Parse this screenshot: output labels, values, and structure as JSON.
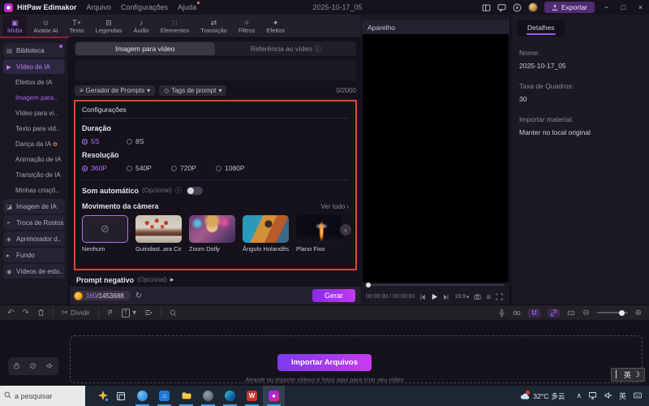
{
  "colors": {
    "accent": "#a873f5",
    "annotation_red": "#df4630",
    "export_purple": "#4f2b72",
    "generate_gradient": [
      "#8a2be2",
      "#bf3bf2"
    ],
    "import_gradient": [
      "#7c3aed",
      "#c93bf0"
    ],
    "taskbar_underline": "#4a9de8"
  },
  "glyphs": {
    "undo": "↶",
    "redo": "↷",
    "scissors": "✂",
    "none": "⊘",
    "info": "ⓘ",
    "caret_down": "▾",
    "caret_right": "▸",
    "chevron_right": "›",
    "next_arrow": "›",
    "refresh": "↻",
    "play": "▶",
    "grid": "⊞",
    "zoom_out": "⊖",
    "zoom_in": "⊕",
    "generator": "≡",
    "tag": "◇",
    "moon": "☽",
    "cursor": "▏",
    "caret_up": "∧",
    "danca": "✿"
  },
  "titlebar": {
    "app_name": "HitPaw Edimakor",
    "menus": [
      "Arquivo",
      "Configurações",
      "Ajuda"
    ],
    "project_name": "2025-10-17_05",
    "export_label": "Exportar",
    "minimize": "−",
    "maximize": "□",
    "close": "×"
  },
  "ribbon": {
    "tabs": [
      {
        "label": "Mídia",
        "icon": "▣"
      },
      {
        "label": "Avatar AI",
        "icon": "☺"
      },
      {
        "label": "Texto",
        "icon": "T+"
      },
      {
        "label": "Legendas",
        "icon": "⊟"
      },
      {
        "label": "Áudio",
        "icon": "♪"
      },
      {
        "label": "Elementos",
        "icon": "∷"
      },
      {
        "label": "Transição",
        "icon": "⇄"
      },
      {
        "label": "Filtros",
        "icon": "✧"
      },
      {
        "label": "Efeitos",
        "icon": "✦"
      }
    ]
  },
  "sidebar": {
    "items": [
      {
        "label": "Biblioteca",
        "icon": "▤"
      },
      {
        "label": "Vídeo de IA",
        "icon": "▶"
      },
      {
        "label": "Efeitos de IA"
      },
      {
        "label": "Imagem para.."
      },
      {
        "label": "Vídeo para vi.."
      },
      {
        "label": "Texto para vid.."
      },
      {
        "label": "Dança da IA"
      },
      {
        "label": "Animação de IA"
      },
      {
        "label": "Transição de IA"
      },
      {
        "label": "Minhas criaçõ.."
      },
      {
        "label": "Imagem de IA",
        "icon": "◪"
      },
      {
        "label": "Troca de Rostos",
        "icon": "◓"
      },
      {
        "label": "Aprimorador d..",
        "icon": "◈"
      },
      {
        "label": "Fundo",
        "icon": "▸"
      },
      {
        "label": "Vídeos de esto..",
        "icon": "◉"
      }
    ]
  },
  "main": {
    "tabs": [
      {
        "label": "Imagem para vídeo"
      },
      {
        "label": "Referência ao vídeo"
      }
    ],
    "prompt_generator": "Gerador de Prompts",
    "prompt_tags": "Tags de prompt",
    "char_counter": "0/2000",
    "settings": {
      "title": "Configurações",
      "duration_label": "Duração",
      "duration_options": [
        "5S",
        "8S"
      ],
      "resolution_label": "Resolução",
      "resolution_options": [
        "360P",
        "540P",
        "720P",
        "1080P"
      ],
      "auto_sound_label": "Som automático",
      "optional_label": "(Opcional)",
      "camera_label": "Movimento da câmera",
      "see_all": "Ver tudo",
      "camera_options": [
        "Nenhum",
        "Guindast..ara Cima",
        "Zoom Dolly",
        "Ângulo Holandês",
        "Plano Fixo"
      ]
    },
    "negative_prompt_label": "Prompt negativo",
    "credits_used": "160",
    "credits_total": "/1453688",
    "generate_label": "Gerar"
  },
  "preview": {
    "title": "Aparelho",
    "timecode": "00:00:00 / 00:00:00",
    "aspect_ratio": "16:9"
  },
  "details": {
    "tab_label": "Detalhes",
    "fields": [
      {
        "label": "Nome:",
        "value": "2025-10-17_05"
      },
      {
        "label": "Taxa de Quadros:",
        "value": "30"
      },
      {
        "label": "Importar material:",
        "value": "Manter no local original"
      }
    ]
  },
  "timeline_toolbar": {
    "split_label": "Dividir"
  },
  "timeline": {
    "import_button": "Importar Arquivos",
    "import_hint": "Arraste ou importe vídeos e fotos aqui para criar seu vídeo"
  },
  "taskbar": {
    "search_text": "a pesquisar",
    "weather_temp": "32°C",
    "weather_desc": "多云",
    "ime_badge": "英",
    "tray_lang": "英"
  }
}
